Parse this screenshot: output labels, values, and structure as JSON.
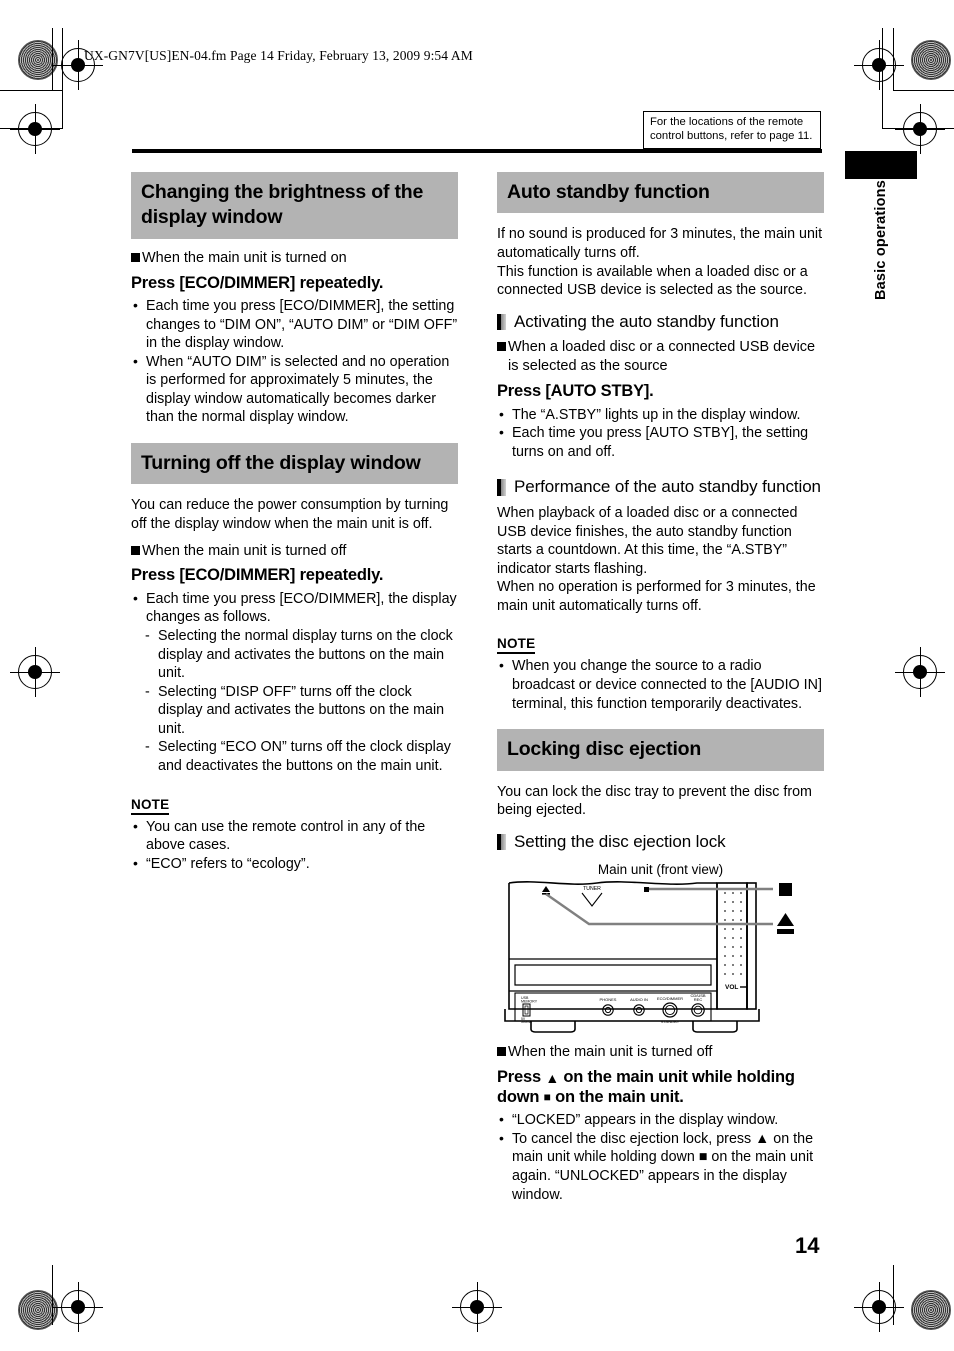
{
  "file_header": "UX-GN7V[US]EN-04.fm  Page 14  Friday, February 13, 2009  9:54 AM",
  "reference_box": "For the locations of the remote control buttons, refer to page 11.",
  "side_tab": "Basic operations",
  "page_number": "14",
  "colors": {
    "heading_band": "#b3b3b3",
    "text": "#000000",
    "page_background": "#ffffff"
  },
  "left_column": {
    "section1": {
      "title": "Changing the brightness of the display window",
      "subhead": "When the main unit is turned on",
      "command": "Press [ECO/DIMMER] repeatedly.",
      "bullets": [
        "Each time you press [ECO/DIMMER], the setting changes to “DIM ON”, “AUTO DIM” or “DIM OFF” in the display window.",
        "When “AUTO DIM” is selected and no operation is performed for approximately 5 minutes, the display window automatically becomes darker than the normal display window."
      ]
    },
    "section2": {
      "title": "Turning off the display window",
      "intro": "You can reduce the power consumption by turning off the display window when the main unit is off.",
      "subhead": "When the main unit is turned off",
      "command": "Press [ECO/DIMMER] repeatedly.",
      "bullets": [
        "Each time you press [ECO/DIMMER], the display changes as follows."
      ],
      "dashes": [
        "Selecting the normal display turns on the clock display and activates the buttons on the main unit.",
        "Selecting “DISP OFF” turns off the clock display and activates the buttons on the main unit.",
        "Selecting “ECO ON” turns off the clock display and deactivates the buttons on the main unit."
      ],
      "note_title": "NOTE",
      "note_bullets": [
        "You can use the remote control in any of the above cases.",
        "“ECO” refers to “ecology”."
      ]
    }
  },
  "right_column": {
    "section1": {
      "title": "Auto standby function",
      "intro_line1": "If no sound is produced for 3 minutes, the main unit automatically turns off.",
      "intro_line2": "This function is available when a loaded disc or a connected USB device is selected as the source.",
      "sub1": {
        "title": "Activating the auto standby function",
        "subhead": "When a loaded disc or a connected USB device is selected as the source",
        "command": "Press [AUTO STBY].",
        "bullets": [
          "The “A.STBY” lights up in the display window.",
          "Each time you press [AUTO STBY], the setting turns on and off."
        ]
      },
      "sub2": {
        "title": "Performance of the auto standby function",
        "para1": "When playback of a loaded disc or a connected USB device finishes, the auto standby function starts a countdown. At this time, the “A.STBY” indicator starts flashing.",
        "para2": "When no operation is performed for 3 minutes, the main unit automatically turns off."
      },
      "note_title": "NOTE",
      "note_bullets": [
        "When you change the source to a radio broadcast or device connected to the [AUDIO IN] terminal, this function temporarily deactivates."
      ]
    },
    "section2": {
      "title": "Locking disc ejection",
      "intro": "You can lock the disc tray to prevent the disc from being ejected.",
      "sub1": {
        "title": "Setting the disc ejection lock",
        "figure_caption": "Main unit (front view)",
        "figure_labels": {
          "tuner": "TUNER",
          "volume": "VOL",
          "usb": "USB",
          "phones": "PHONES",
          "audio_in": "AUDIO IN",
          "eco_dimmer": "ECO/DIMMER",
          "standby": "STANDBY",
          "cd_usb_rec": "CD/USB REC"
        },
        "callout_stop_icon": "stop-square-icon",
        "callout_eject_icon": "eject-triangle-icon"
      },
      "subhead": "When the main unit is turned off",
      "command_part1": "Press ",
      "command_eject": "▲",
      "command_part2": " on the main unit while holding down ",
      "command_stop": "■",
      "command_part3": " on the main unit.",
      "bullets": [
        "“LOCKED” appears in the display window.",
        "To cancel the disc ejection lock, press ▲ on the main unit while holding down ■ on the main unit again. “UNLOCKED” appears in the display window."
      ]
    }
  }
}
